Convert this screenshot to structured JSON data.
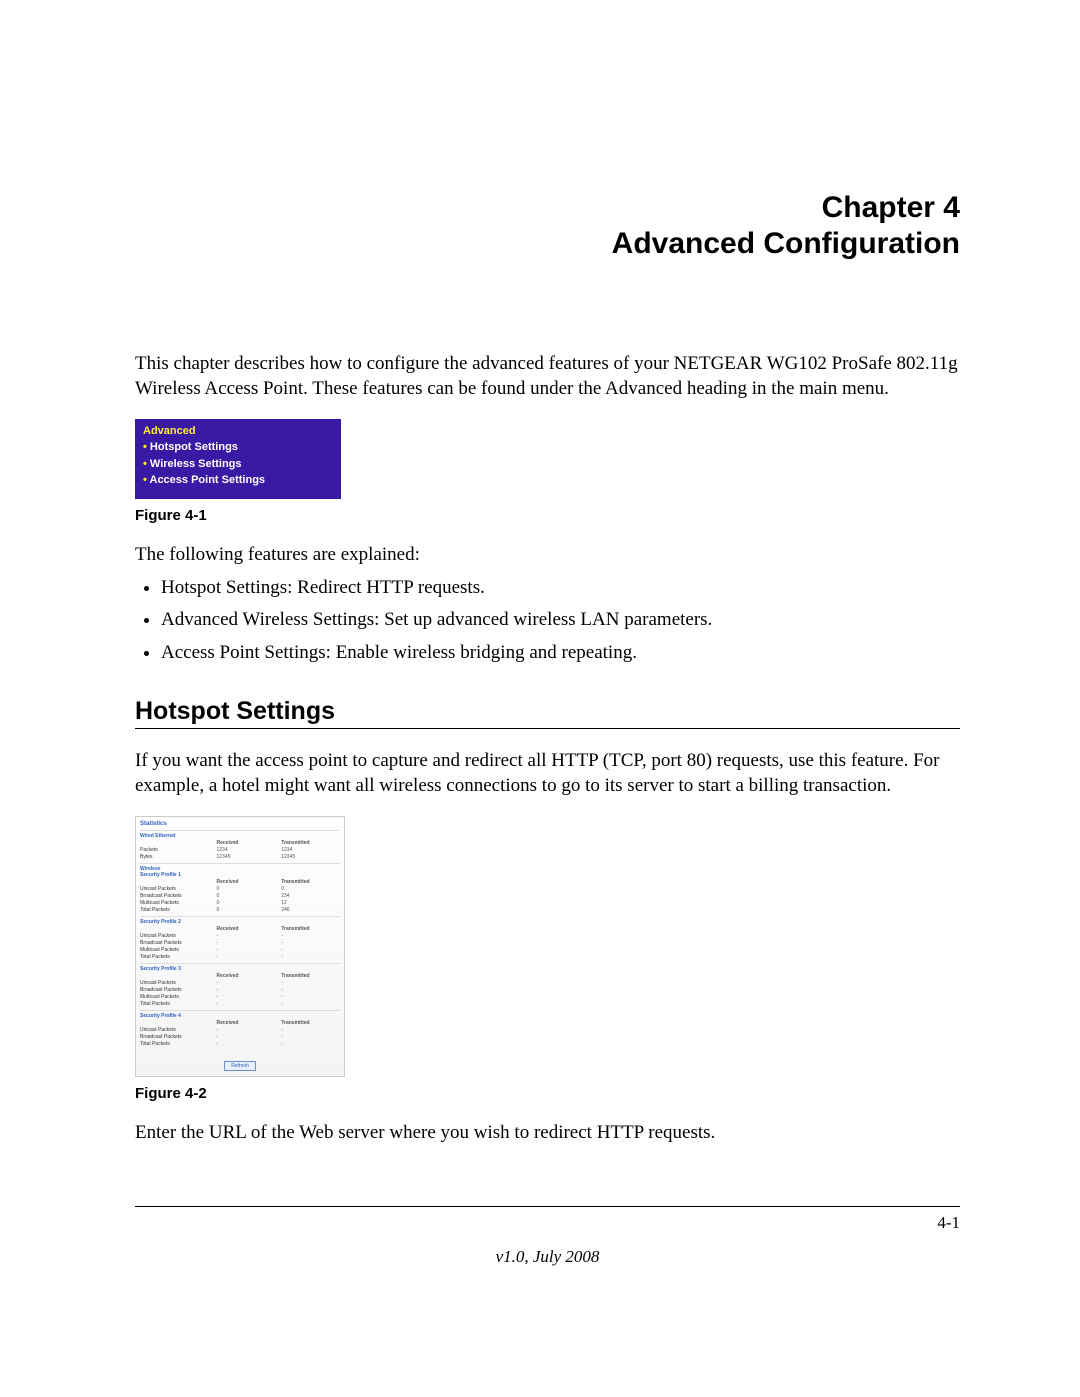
{
  "chapter": {
    "line1": "Chapter 4",
    "line2": "Advanced Configuration"
  },
  "intro": "This chapter describes how to configure the advanced features of your NETGEAR WG102 ProSafe 802.11g Wireless Access Point. These features can be found under the Advanced heading in the main menu.",
  "menu": {
    "heading": "Advanced",
    "items": [
      "Hotspot Settings",
      "Wireless Settings",
      "Access Point Settings"
    ]
  },
  "figure1_caption": "Figure 4-1",
  "features_intro": "The following features are explained:",
  "features": [
    "Hotspot Settings: Redirect HTTP requests.",
    "Advanced Wireless Settings: Set up advanced wireless LAN parameters.",
    "Access Point Settings: Enable wireless bridging and repeating."
  ],
  "section_heading": "Hotspot Settings",
  "hotspot_para": "If you want the access point to capture and redirect all HTTP (TCP, port 80) requests, use this feature. For example, a hotel might want all wireless connections to go to its server to start a billing transaction.",
  "figure2_caption": "Figure 4-2",
  "post_fig2": "Enter the URL of the Web server where you wish to redirect HTTP requests.",
  "footer": {
    "page": "4-1",
    "version": "v1.0, July 2008"
  }
}
